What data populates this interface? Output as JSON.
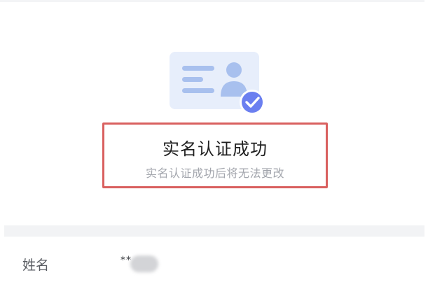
{
  "verification": {
    "title": "实名认证成功",
    "subtitle": "实名认证成功后将无法更改"
  },
  "info": {
    "name_label": "姓名",
    "name_value": "**"
  },
  "colors": {
    "highlight_border": "#d9605f",
    "card_background": "#e7eefb",
    "accent_blue": "#6b7ff0",
    "muted_text": "#a3a6ad",
    "section_gap": "#f2f3f5"
  },
  "icons": {
    "illustration": "id-card-verified-icon",
    "check": "check-badge-icon"
  }
}
